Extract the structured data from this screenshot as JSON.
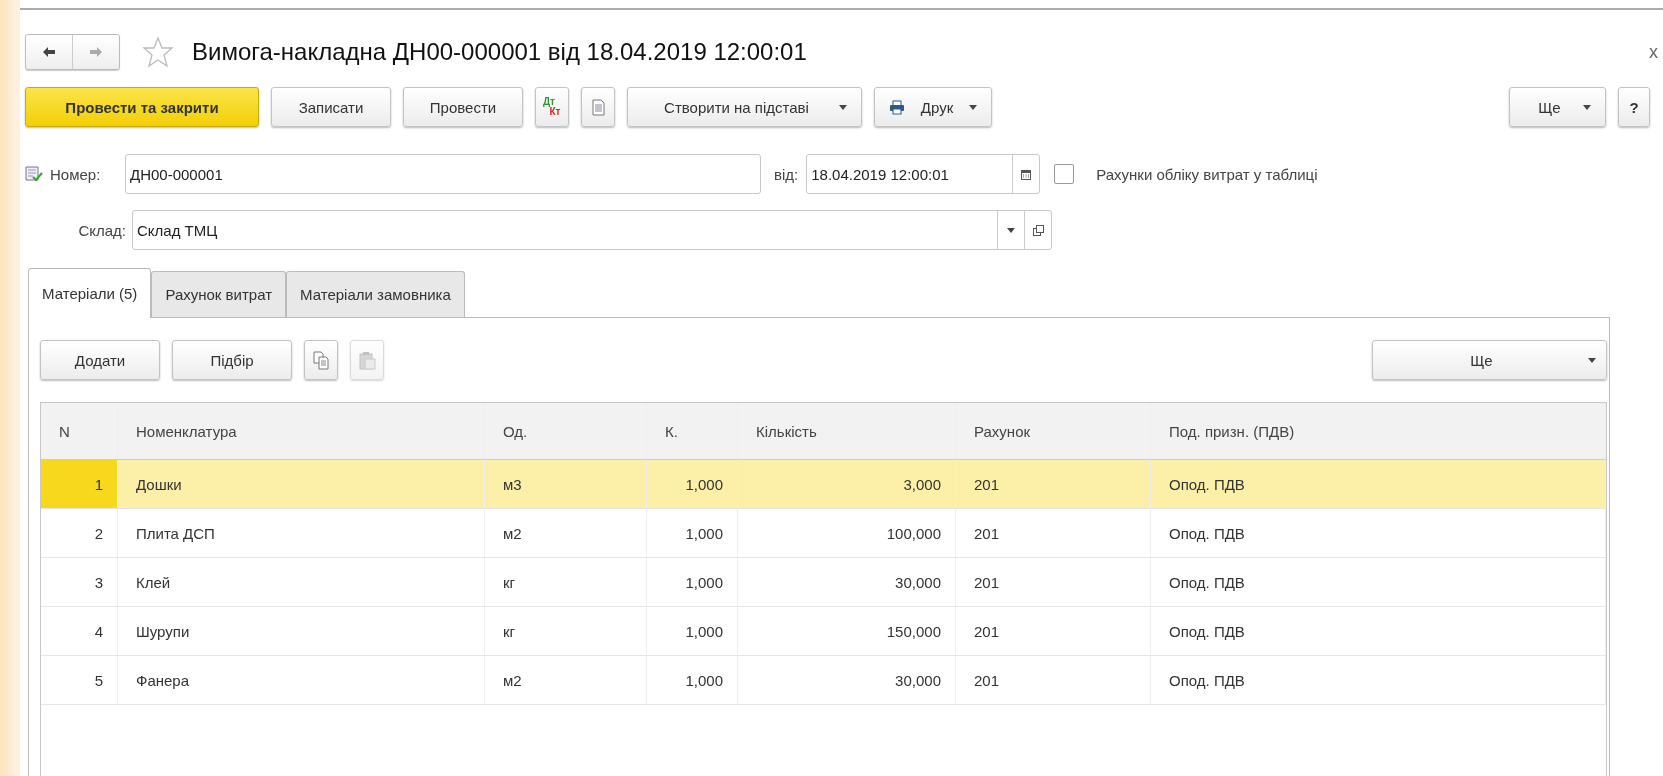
{
  "window": {
    "title": "Вимога-накладна ДН00-000001 від 18.04.2019 12:00:01",
    "close": "x",
    "favorite": false
  },
  "toolbar": [
    {
      "kind": "primary",
      "label": "Провести та закрити"
    },
    {
      "kind": "normal",
      "label": "Записати"
    },
    {
      "kind": "normal",
      "label": "Провести"
    },
    {
      "kind": "dtkt",
      "top": "Дт",
      "bottom": "Кт"
    },
    {
      "kind": "doc"
    },
    {
      "kind": "dropdown",
      "label": "Створити на підставі"
    },
    {
      "kind": "print",
      "label": "Друк"
    },
    {
      "kind": "spacer"
    },
    {
      "kind": "dropdown",
      "label": "Ще"
    },
    {
      "kind": "normal",
      "label": "?"
    }
  ],
  "header": {
    "number_label": "Номер:",
    "number": "ДН00-000001",
    "date_label": "від:",
    "date": "18.04.2019 12:00:01",
    "cost_accounts_in_table": {
      "label": "Рахунки обліку витрат у таблиці",
      "checked": false
    },
    "warehouse_label": "Склад:",
    "warehouse": "Склад ТМЦ"
  },
  "tabs": [
    {
      "label": "Матеріали (5)",
      "selected": true
    },
    {
      "label": "Рахунок витрат",
      "selected": false
    },
    {
      "label": "Матеріали замовника",
      "selected": false
    }
  ],
  "table_toolbar": [
    {
      "kind": "normal",
      "label": "Додати"
    },
    {
      "kind": "normal",
      "label": "Підбір"
    },
    {
      "kind": "copy",
      "disabled": false
    },
    {
      "kind": "paste",
      "disabled": true
    },
    {
      "kind": "spacer"
    },
    {
      "kind": "dropdown",
      "label": "Ще"
    }
  ],
  "table": {
    "columns": [
      "N",
      "Номенклатура",
      "Од.",
      "К.",
      "Кількість",
      "Рахунок",
      "Под. призн. (ПДВ)"
    ],
    "rows": [
      {
        "selected": true,
        "cells": [
          "1",
          "Дошки",
          "м3",
          "1,000",
          "3,000",
          "201",
          "Опод. ПДВ"
        ]
      },
      {
        "selected": false,
        "cells": [
          "2",
          "Плита ДСП",
          "м2",
          "1,000",
          "100,000",
          "201",
          "Опод. ПДВ"
        ]
      },
      {
        "selected": false,
        "cells": [
          "3",
          "Клей",
          "кг",
          "1,000",
          "30,000",
          "201",
          "Опод. ПДВ"
        ]
      },
      {
        "selected": false,
        "cells": [
          "4",
          "Шурупи",
          "кг",
          "1,000",
          "150,000",
          "201",
          "Опод. ПДВ"
        ]
      },
      {
        "selected": false,
        "cells": [
          "5",
          "Фанера",
          "м2",
          "1,000",
          "30,000",
          "201",
          "Опод. ПДВ"
        ]
      }
    ]
  }
}
